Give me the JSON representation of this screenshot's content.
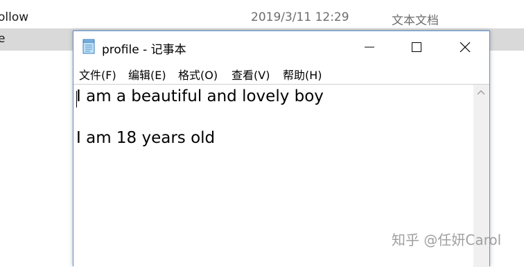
{
  "explorer": {
    "rows": [
      {
        "name": "ollow",
        "date": "2019/3/11 12:29",
        "type": "文本文档"
      },
      {
        "name": "e",
        "date": "",
        "type": ""
      }
    ]
  },
  "notepad": {
    "title": "profile - 记事本",
    "menu": [
      "文件(F)",
      "编辑(E)",
      "格式(O)",
      "查看(V)",
      "帮助(H)"
    ],
    "content": {
      "line1": "I am a beautiful and lovely boy",
      "line2": "I am 18 years old"
    }
  },
  "watermark": "知乎 @任妍Carol",
  "colors": {
    "window_border": "#5a8fcf",
    "selected_row": "#d9d9d9"
  }
}
